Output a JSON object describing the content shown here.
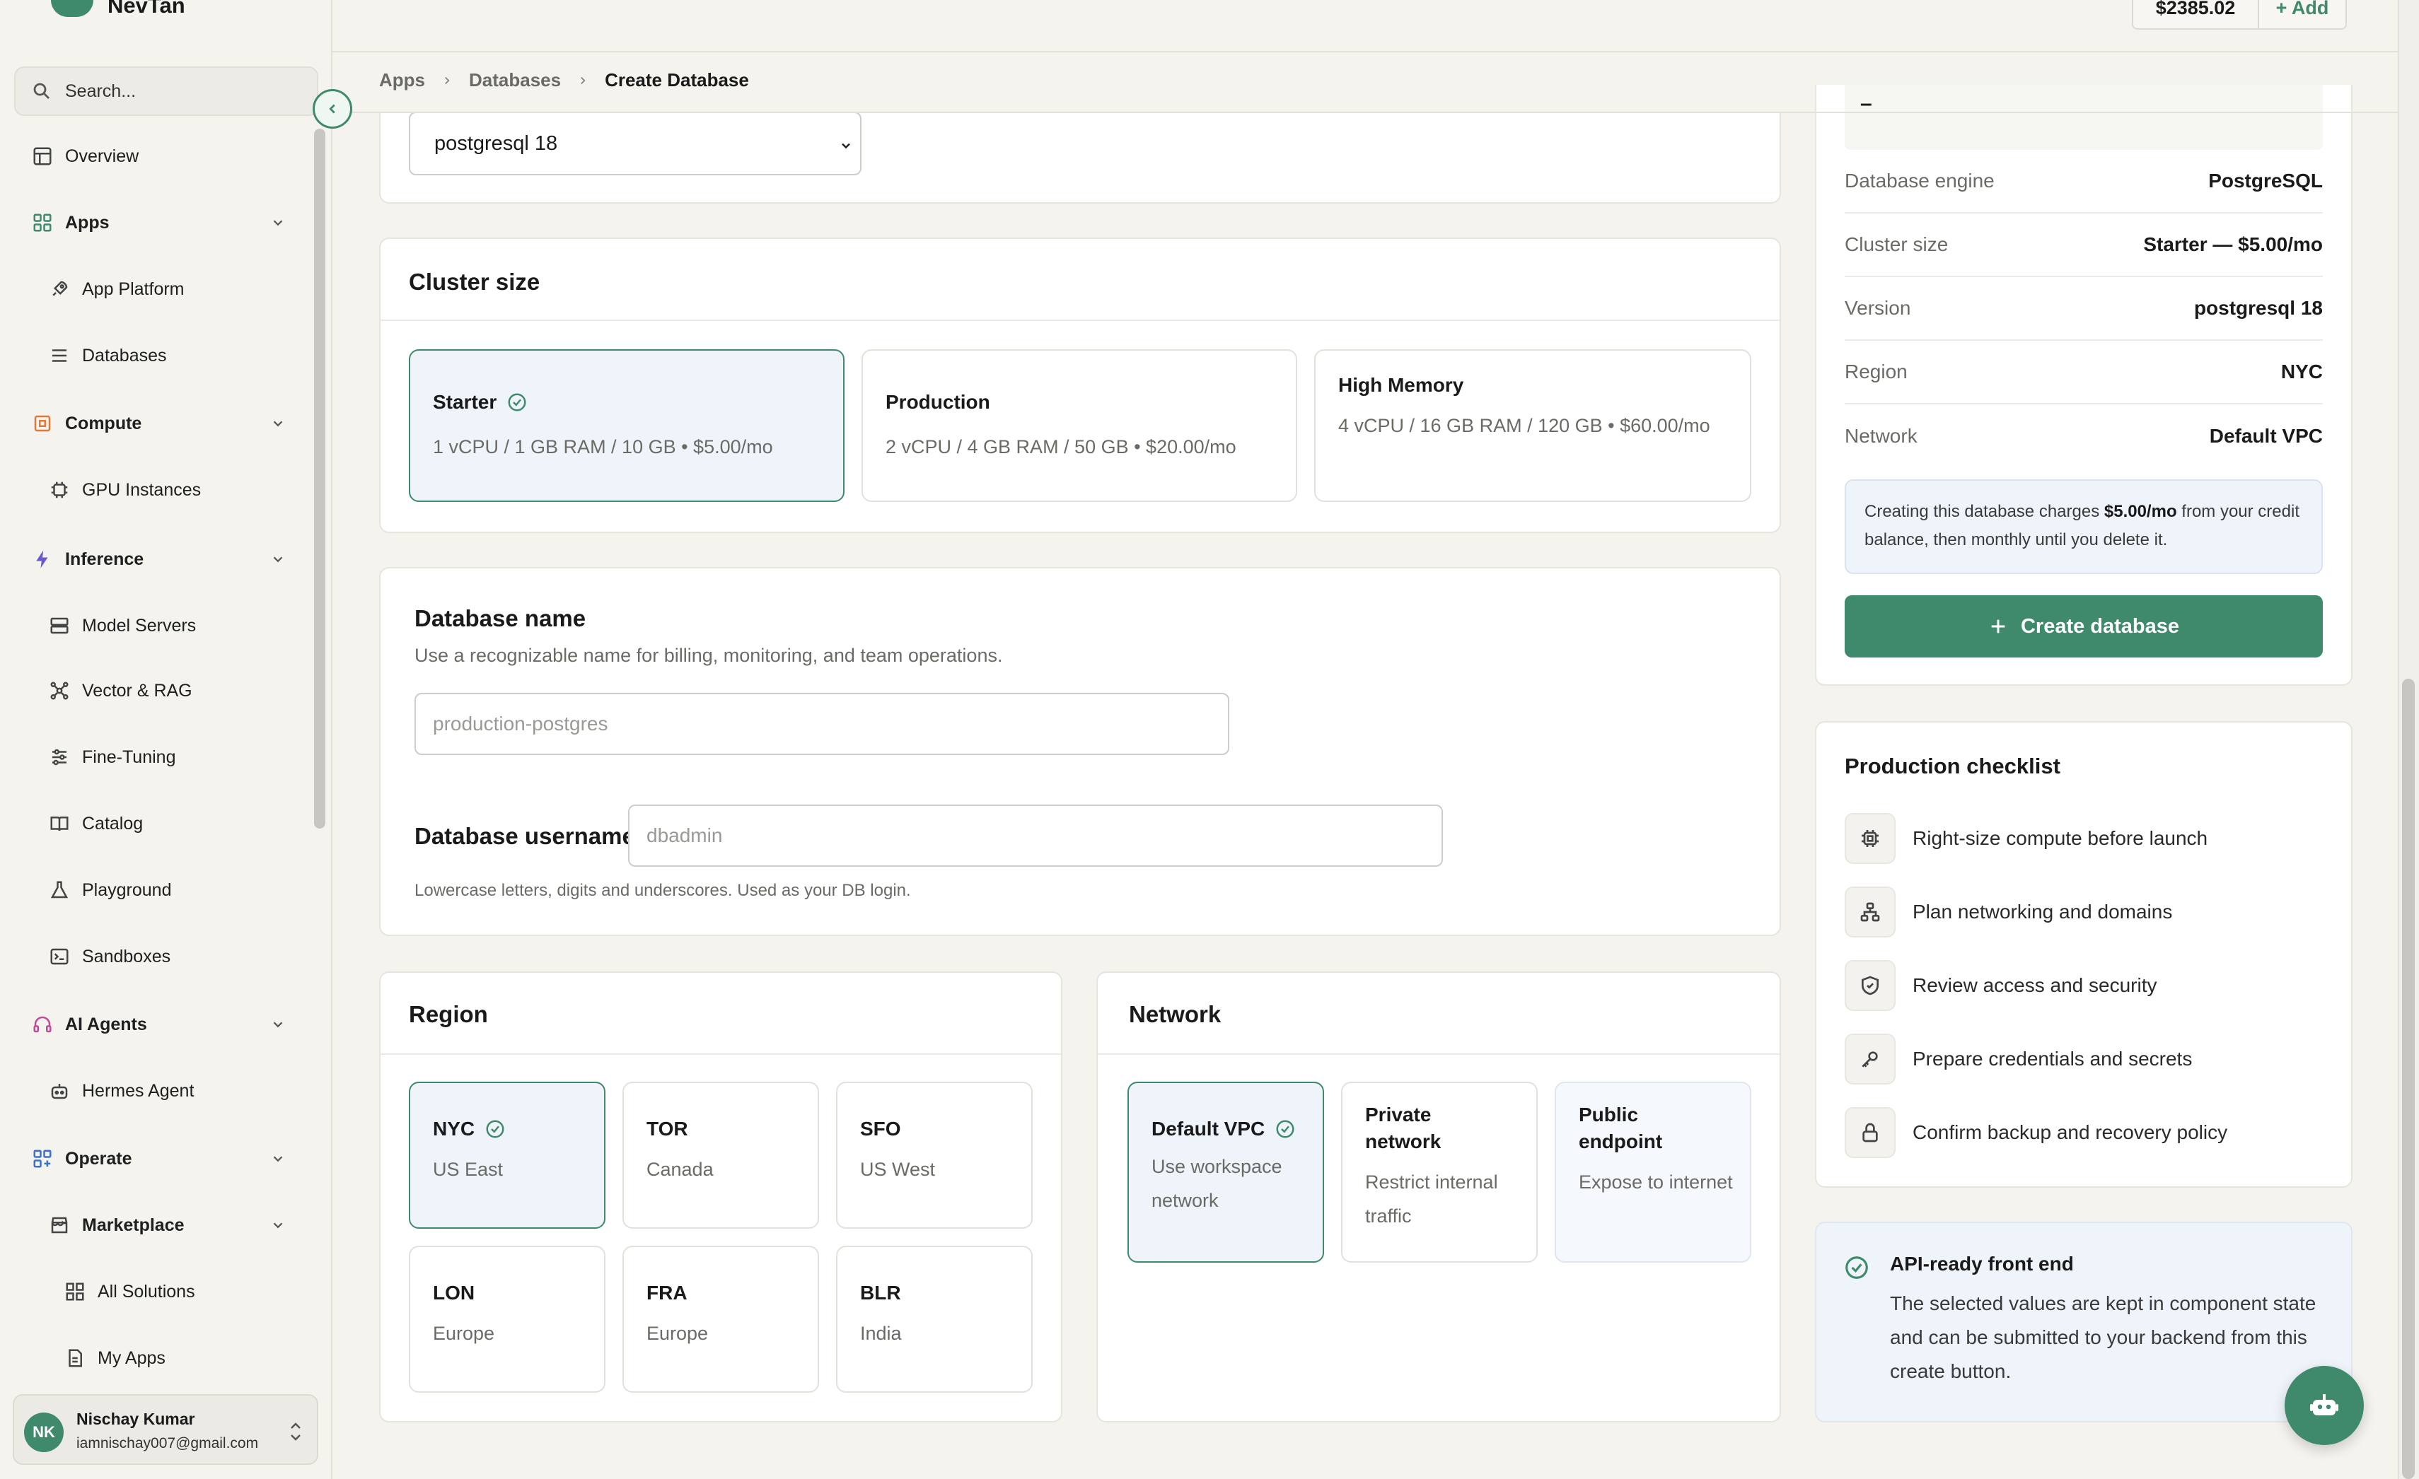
{
  "brand": {
    "name": "NevTan",
    "accent": "#3e8a6a"
  },
  "sidebar": {
    "search_placeholder": "Search...",
    "items": {
      "overview": "Overview",
      "apps": "Apps",
      "app_platform": "App Platform",
      "databases": "Databases",
      "compute": "Compute",
      "gpu_instances": "GPU Instances",
      "inference": "Inference",
      "model_servers": "Model Servers",
      "vector_rag": "Vector & RAG",
      "fine_tuning": "Fine-Tuning",
      "catalog": "Catalog",
      "playground": "Playground",
      "sandboxes": "Sandboxes",
      "ai_agents": "AI Agents",
      "hermes_agent": "Hermes Agent",
      "operate": "Operate",
      "marketplace": "Marketplace",
      "all_solutions": "All Solutions",
      "my_apps": "My Apps"
    },
    "user": {
      "initials": "NK",
      "name": "Nischay Kumar",
      "email": "iamnischay007@gmail.com"
    }
  },
  "topbar": {
    "balance": "$2385.02",
    "add_label": "+ Add"
  },
  "breadcrumb": {
    "apps": "Apps",
    "databases": "Databases",
    "current": "Create Database"
  },
  "version_select": {
    "value": "postgresql 18"
  },
  "cluster": {
    "title": "Cluster size",
    "options": [
      {
        "name": "Starter",
        "desc": "1 vCPU / 1 GB RAM / 10 GB • $5.00/mo",
        "selected": true
      },
      {
        "name": "Production",
        "desc": "2 vCPU / 4 GB RAM / 50 GB • $20.00/mo",
        "selected": false
      },
      {
        "name": "High Memory",
        "desc": "4 vCPU / 16 GB RAM / 120 GB • $60.00/mo",
        "selected": false
      }
    ]
  },
  "db_name": {
    "label": "Database name",
    "help": "Use a recognizable name for billing, monitoring, and team operations.",
    "placeholder": "production-postgres"
  },
  "db_user": {
    "label": "Database username",
    "placeholder": "dbadmin",
    "help": "Lowercase letters, digits and underscores. Used as your DB login."
  },
  "region": {
    "title": "Region",
    "options": [
      {
        "code": "NYC",
        "place": "US East",
        "selected": true
      },
      {
        "code": "TOR",
        "place": "Canada",
        "selected": false
      },
      {
        "code": "SFO",
        "place": "US West",
        "selected": false
      },
      {
        "code": "LON",
        "place": "Europe",
        "selected": false
      },
      {
        "code": "FRA",
        "place": "Europe",
        "selected": false
      },
      {
        "code": "BLR",
        "place": "India",
        "selected": false
      }
    ]
  },
  "network": {
    "title": "Network",
    "options": [
      {
        "name": "Default VPC",
        "desc": "Use workspace network",
        "selected": true
      },
      {
        "name": "Private network",
        "desc": "Restrict internal traffic",
        "selected": false
      },
      {
        "name": "Public endpoint",
        "desc": "Expose to internet",
        "selected": false
      }
    ]
  },
  "summary": {
    "dash": "–",
    "rows": [
      {
        "k": "Database engine",
        "v": "PostgreSQL"
      },
      {
        "k": "Cluster size",
        "v": "Starter — $5.00/mo"
      },
      {
        "k": "Version",
        "v": "postgresql 18"
      },
      {
        "k": "Region",
        "v": "NYC"
      },
      {
        "k": "Network",
        "v": "Default VPC"
      }
    ],
    "notice_pre": "Creating this database charges ",
    "notice_amount": "$5.00/mo",
    "notice_post": " from your credit balance, then monthly until you delete it.",
    "create_label": "Create database"
  },
  "checklist": {
    "title": "Production checklist",
    "items": [
      {
        "icon": "cpu-icon",
        "label": "Right-size compute before launch"
      },
      {
        "icon": "network-icon",
        "label": "Plan networking and domains"
      },
      {
        "icon": "shield-icon",
        "label": "Review access and security"
      },
      {
        "icon": "key-icon",
        "label": "Prepare credentials and secrets"
      },
      {
        "icon": "lock-icon",
        "label": "Confirm backup and recovery policy"
      }
    ]
  },
  "api_card": {
    "title": "API-ready front end",
    "text": "The selected values are kept in component state and can be submitted to your backend from this create button."
  }
}
